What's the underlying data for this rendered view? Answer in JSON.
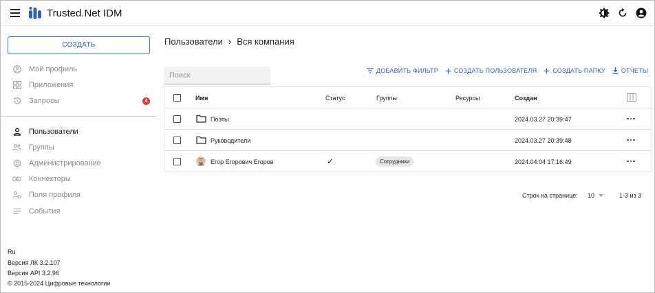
{
  "app": {
    "title": "Trusted.Net IDM"
  },
  "colors": {
    "accent": "#2f63b1",
    "badge": "#e53935",
    "logo": "#2f63b1"
  },
  "topbar": {
    "icons": [
      "theme-toggle-icon",
      "refresh-icon",
      "account-icon"
    ]
  },
  "sidebar": {
    "create_label": "СОЗДАТЬ",
    "items_top": [
      {
        "label": "Мой профиль",
        "icon": "account-circle-icon"
      },
      {
        "label": "Приложения",
        "icon": "apps-icon"
      },
      {
        "label": "Запросы",
        "icon": "history-icon",
        "badge": "4"
      }
    ],
    "items_bottom": [
      {
        "label": "Пользователи",
        "icon": "person-icon",
        "active": true
      },
      {
        "label": "Группы",
        "icon": "group-icon"
      },
      {
        "label": "Администрирование",
        "icon": "settings-icon"
      },
      {
        "label": "Коннекторы",
        "icon": "link-icon"
      },
      {
        "label": "Поля профиля",
        "icon": "profile-fields-icon"
      },
      {
        "label": "События",
        "icon": "events-icon"
      }
    ],
    "footer": {
      "lang": "Ru",
      "lk_version": "Версия ЛК 3.2.107",
      "api_version": "Версия API 3.2.96",
      "copyright": "© 2015-2024 Цифровые технологии"
    }
  },
  "breadcrumb": {
    "part1": "Пользователи",
    "sep": "›",
    "part2": "Вся компания"
  },
  "search": {
    "placeholder": "Поиск"
  },
  "actions": {
    "add_filter": "ДОБАВИТЬ ФИЛЬТР",
    "create_user": "СОЗДАТЬ ПОЛЬЗОВАТЕЛЯ",
    "create_folder": "СОЗДАТЬ ПАПКУ",
    "reports": "ОТЧЕТЫ"
  },
  "table": {
    "headers": {
      "name": "Имя",
      "status": "Статус",
      "groups": "Группы",
      "resources": "Ресурсы",
      "created": "Создан"
    },
    "rows": [
      {
        "type": "folder",
        "name": "Поэты",
        "status": "",
        "group": "",
        "created": "2024.03.27 20:39:47"
      },
      {
        "type": "folder",
        "name": "Руководители",
        "status": "",
        "group": "",
        "created": "2024.03.27 20:39:48"
      },
      {
        "type": "user",
        "name": "Егор Егорович Егоров",
        "status": "✓",
        "group": "Сотрудники",
        "created": "2024.04.04 17:16:49"
      }
    ]
  },
  "pagination": {
    "rows_label": "Строк на странице:",
    "rows_value": "10",
    "range": "1-3 из 3"
  }
}
